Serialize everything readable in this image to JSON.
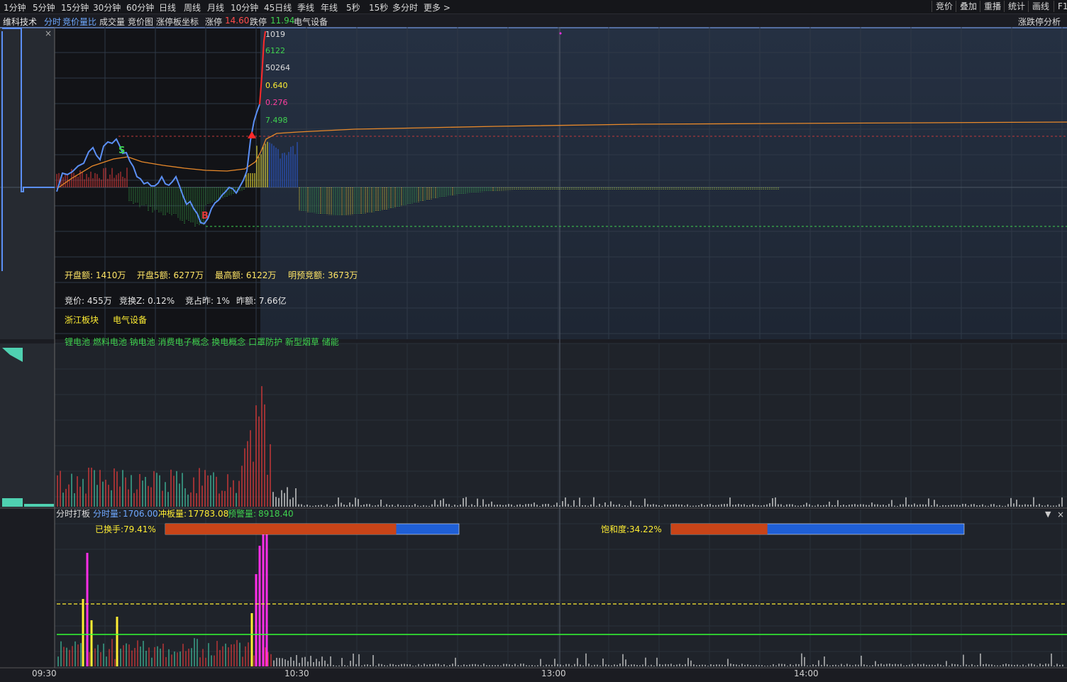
{
  "toolbar": {
    "periods": [
      "1分钟",
      "5分钟",
      "15分钟",
      "30分钟",
      "60分钟",
      "日线",
      "周线",
      "月线",
      "10分钟",
      "45日线",
      "季线",
      "年线",
      "5秒",
      "15秒",
      "多分时",
      "更多 >"
    ],
    "right": [
      "竞价",
      "叠加",
      "重播",
      "统计",
      "画线",
      "F1"
    ]
  },
  "subbar": {
    "stock_name": "维科技术",
    "tabs": [
      "分时",
      "竞价量比",
      "成交量",
      "竞价图",
      "涨停板坐标"
    ],
    "limit_up_label": "涨停",
    "limit_up_value": "14.60",
    "limit_down_label": "跌停",
    "limit_down_value": "11.94",
    "sector": "电气设备",
    "right_button": "涨跌停分析"
  },
  "price_panel": {
    "right_values": [
      "1019",
      "6122",
      "50264",
      "0.640",
      "0.276",
      "7.498"
    ],
    "stats_row1": [
      "开盘额: 1410万",
      "开盘5额: 6277万",
      "最高额: 6122万",
      "明预竞额: 3673万"
    ],
    "stats_row2": [
      "竞价: 455万",
      "竞换Z: 0.12%",
      "竞占昨: 1%",
      "昨额: 7.66亿"
    ],
    "blocks": [
      "浙江板块",
      "电气设备"
    ],
    "concepts": "锂电池 燃料电池 钠电池 消费电子概念 换电概念 口罩防护 新型烟草 储能",
    "markers": {
      "sell": "S",
      "buy": "B"
    },
    "close_glyph": "×"
  },
  "indicator_panel": {
    "title": "分时打板",
    "vol_label": "分时量:",
    "vol_value": "1706.00",
    "limit_label": "冲板量:",
    "limit_value": "17783.08",
    "warn_label": "预警量:",
    "warn_value": "8918.40",
    "turnover_label": "已换手:79.41%",
    "turnover_fill": 0.7941,
    "saturation_label": "饱和度:34.22%",
    "saturation_fill": 0.3422
  },
  "time_axis": [
    "09:30",
    "10:30",
    "13:00",
    "14:00"
  ],
  "colors": {
    "up": "#e03a3a",
    "down": "#3fbf4f",
    "price_line": "#5b8ff5",
    "avg_line": "#e8892a",
    "magenta": "#ff2ee8",
    "yellow": "#ffee33",
    "green_line": "#33ff33"
  }
}
